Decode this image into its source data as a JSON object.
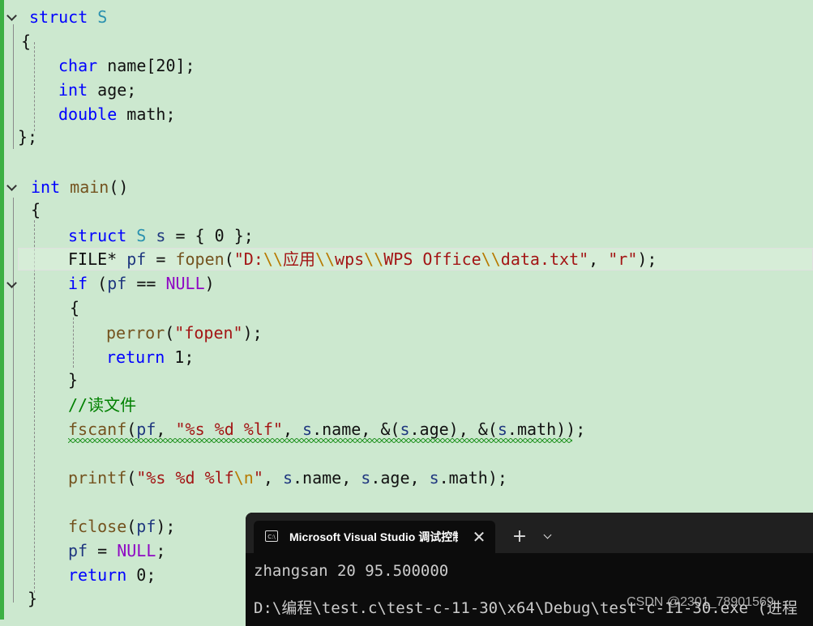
{
  "editor": {
    "lines": {
      "l1": {
        "kw": "struct",
        "name": "S"
      },
      "l2": "{",
      "l3": {
        "type": "char",
        "rest": " name[20];"
      },
      "l4": {
        "type": "int",
        "rest": " age;"
      },
      "l5": {
        "type": "double",
        "rest": " math;"
      },
      "l6": "};",
      "l8": {
        "type": "int",
        "fn": "main",
        "rest": "()"
      },
      "l9": "{",
      "l10": {
        "kw": "struct",
        "tname": "S",
        "var": "s",
        "rest": " = { 0 };"
      },
      "l11": {
        "a": "FILE* ",
        "v": "pf",
        "b": " = ",
        "fn": "fopen",
        "c": "(",
        "s1": "\"D:",
        "e1": "\\\\",
        "s2": "应用",
        "e2": "\\\\",
        "s3": "wps",
        "e3": "\\\\",
        "s4": "WPS Office",
        "e4": "\\\\",
        "s5": "data.txt\"",
        "d": ", ",
        "s6": "\"r\"",
        "f": ");"
      },
      "l12": {
        "kw": "if",
        "a": " (",
        "v": "pf",
        "b": " == ",
        "m": "NULL",
        "c": ")"
      },
      "l13": "{",
      "l14": {
        "fn": "perror",
        "a": "(",
        "s": "\"fopen\"",
        "b": ");"
      },
      "l15": {
        "kw": "return",
        "rest": " 1;"
      },
      "l16": "}",
      "l17": "//读文件",
      "l18": {
        "fn": "fscanf",
        "a": "(",
        "v1": "pf",
        "b": ", ",
        "s": "\"%s %d %lf\"",
        "c": ", ",
        "v2": "s",
        "d": ".name, &(",
        "v3": "s",
        "e": ".age), &(",
        "v4": "s",
        "f": ".math));"
      },
      "l20": {
        "fn": "printf",
        "a": "(",
        "s1": "\"%s %d %lf",
        "e": "\\n",
        "s2": "\"",
        "b": ", ",
        "v1": "s",
        "c": ".name, ",
        "v2": "s",
        "d": ".age, ",
        "v3": "s",
        "f": ".math);"
      },
      "l22": {
        "fn": "fclose",
        "a": "(",
        "v": "pf",
        "b": ");"
      },
      "l23": {
        "v": "pf",
        "a": " = ",
        "m": "NULL",
        "b": ";"
      },
      "l24": {
        "kw": "return",
        "rest": " 0;"
      },
      "l25": "}"
    }
  },
  "terminal": {
    "tab_title": "Microsoft Visual Studio 调试控制台",
    "close_glyph": "✕",
    "plus_glyph": "+",
    "icon_text": "C:\\",
    "output_line": "zhangsan 20 95.500000",
    "path_line": "D:\\编程\\test.c\\test-c-11-30\\x64\\Debug\\test-c-11-30.exe (进程"
  },
  "watermark": "CSDN @2301_78901569"
}
